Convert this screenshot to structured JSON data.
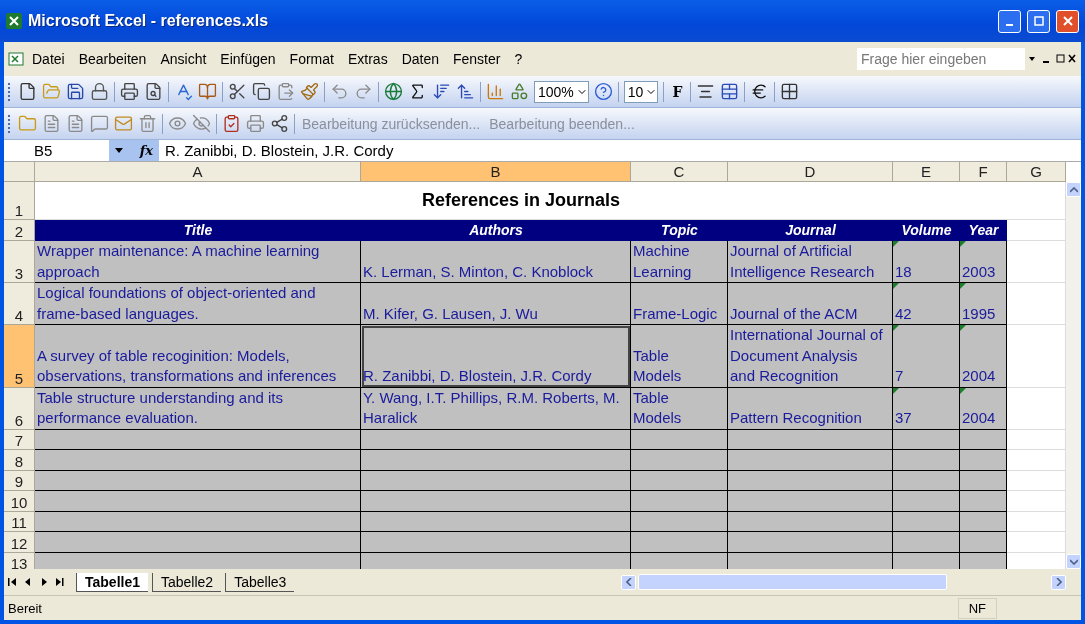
{
  "window": {
    "title": "Microsoft Excel - references.xls"
  },
  "menu": [
    {
      "label": "Datei"
    },
    {
      "label": "Bearbeiten"
    },
    {
      "label": "Ansicht"
    },
    {
      "label": "Einfügen"
    },
    {
      "label": "Format"
    },
    {
      "label": "Extras"
    },
    {
      "label": "Daten"
    },
    {
      "label": "Fenster"
    },
    {
      "label": "?"
    }
  ],
  "help_box": {
    "placeholder": "Frage hier eingeben"
  },
  "toolbar": {
    "zoom": "100%",
    "font_size": "10",
    "bold_label": "F"
  },
  "review_toolbar": {
    "buttons": [
      {
        "label": "Bearbeitung zurücksenden...",
        "disabled": true
      },
      {
        "label": "Bearbeitung beenden...",
        "disabled": true
      }
    ]
  },
  "formula_bar": {
    "name_box": "B5",
    "function_label": "fx",
    "value": "R. Zanibbi, D. Blostein, J.R. Cordy"
  },
  "columns": [
    {
      "label": "A",
      "selected": false
    },
    {
      "label": "B",
      "selected": true
    },
    {
      "label": "C",
      "selected": false
    },
    {
      "label": "D",
      "selected": false
    },
    {
      "label": "E",
      "selected": false
    },
    {
      "label": "F",
      "selected": false
    },
    {
      "label": "G",
      "selected": false
    }
  ],
  "sheet_title": "References in Journals",
  "header_row": {
    "number": "2",
    "cells": [
      "Title",
      "Authors",
      "Topic",
      "Journal",
      "Volume",
      "Year"
    ]
  },
  "rows": [
    {
      "number": "3",
      "selected": false,
      "flagged": true,
      "cells": [
        "Wrapper maintenance: A machine learning approach",
        "K. Lerman, S. Minton, C. Knoblock",
        "Machine Learning",
        "Journal of Artificial Intelligence Research",
        "18",
        "2003"
      ]
    },
    {
      "number": "4",
      "selected": false,
      "flagged": true,
      "cells": [
        "Logical foundations of object-oriented and frame-based languages.",
        "M. Kifer, G. Lausen, J. Wu",
        "Frame-Logic",
        "Journal of the ACM",
        "42",
        "1995"
      ]
    },
    {
      "number": "5",
      "selected": true,
      "flagged": true,
      "cells": [
        "A survey of table recoginition: Models, observations, transformations and inferences",
        "R. Zanibbi, D. Blostein, J.R. Cordy",
        "Table Models",
        "International Journal of Document Analysis and Recognition",
        "7",
        "2004"
      ]
    },
    {
      "number": "6",
      "selected": false,
      "flagged": true,
      "cells": [
        "Table structure understanding and its performance evaluation.",
        "Y. Wang, I.T. Phillips, R.M. Roberts, M. Haralick",
        "Table Models",
        "Pattern Recognition",
        "37",
        "2004"
      ]
    }
  ],
  "title_row_number": "1",
  "empty_rows": [
    "7",
    "8",
    "9",
    "10",
    "11",
    "12",
    "13"
  ],
  "sheet_tabs": [
    {
      "label": "Tabelle1",
      "selected": true
    },
    {
      "label": "Tabelle2",
      "selected": false
    },
    {
      "label": "Tabelle3",
      "selected": false
    }
  ],
  "status_bar": {
    "text": "Bereit",
    "indicators": [
      "NF"
    ]
  }
}
